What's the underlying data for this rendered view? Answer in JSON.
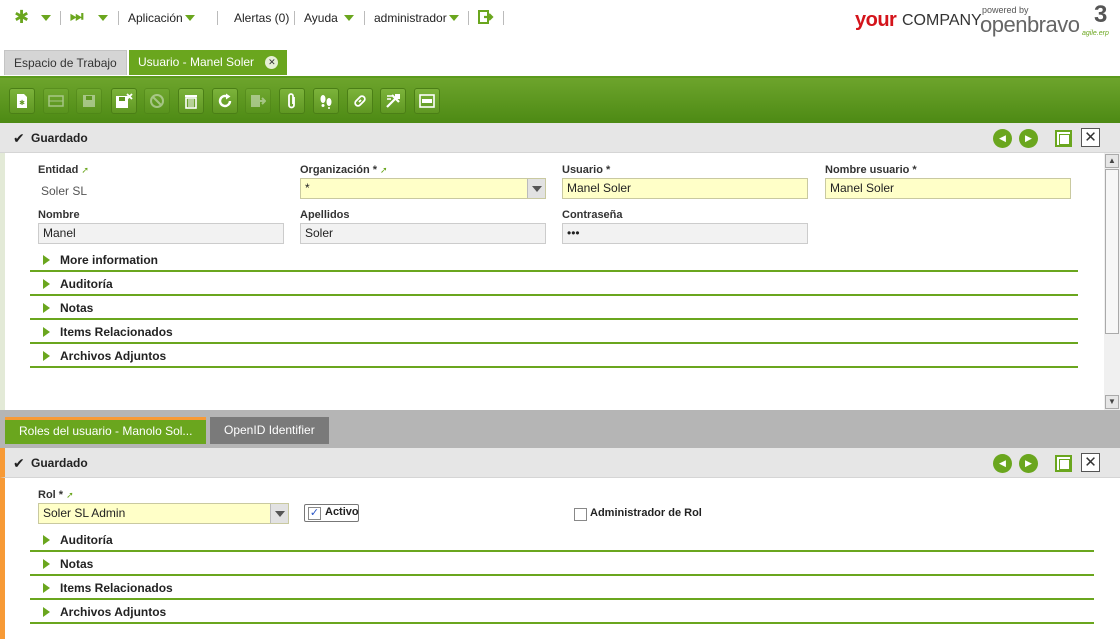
{
  "nav": {
    "aplicacion": "Aplicación",
    "alertas": "Alertas (0)",
    "ayuda": "Ayuda",
    "user": "administrador"
  },
  "brand": {
    "your": "your",
    "company": "COMPANY",
    "powered": "powered by",
    "openbravo": "openbravo",
    "version": "3",
    "agile": "agile.erp"
  },
  "tabs": {
    "workspace": "Espacio de Trabajo",
    "current": "Usuario - Manel Soler"
  },
  "status": {
    "top": "Guardado",
    "bottom": "Guardado"
  },
  "form": {
    "entidad_label": "Entidad",
    "entidad_value": "Soler SL",
    "org_label": "Organización *",
    "org_value": "*",
    "usuario_label": "Usuario *",
    "usuario_value": "Manel Soler",
    "nombre_usuario_label": "Nombre usuario *",
    "nombre_usuario_value": "Manel Soler",
    "nombre_label": "Nombre",
    "nombre_value": "Manel",
    "apellidos_label": "Apellidos",
    "apellidos_value": "Soler",
    "password_label": "Contraseña",
    "password_value": "•••",
    "sections": [
      "More information",
      "Auditoría",
      "Notas",
      "Items Relacionados",
      "Archivos Adjuntos"
    ]
  },
  "child_tabs": {
    "roles": "Roles del usuario - Manolo Sol...",
    "openid": "OpenID Identifier"
  },
  "child_form": {
    "rol_label": "Rol *",
    "rol_value": "Soler SL Admin",
    "activo_label": "Activo",
    "activo_checked": true,
    "admin_label": "Administrador de Rol",
    "admin_checked": false,
    "sections": [
      "Auditoría",
      "Notas",
      "Items Relacionados",
      "Archivos Adjuntos"
    ]
  },
  "colors": {
    "accent": "#6aa61e",
    "orange": "#f79a36",
    "required_field": "#ffffc8"
  }
}
